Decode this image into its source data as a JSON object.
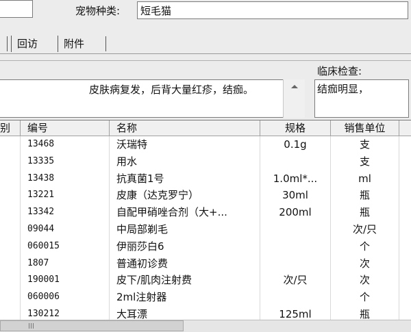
{
  "header": {
    "pet_type_label": "宠物种类:",
    "pet_type_value": "短毛猫"
  },
  "tabs": [
    {
      "label": "回访"
    },
    {
      "label": "附件"
    }
  ],
  "record": {
    "complaint_text": "皮肤病复发，后背大量红疹，结痂。",
    "clinical_label": "临床检查:",
    "clinical_text": "结痂明显，"
  },
  "grid": {
    "columns": {
      "prev": "别",
      "code": "编号",
      "name": "名称",
      "spec": "规格",
      "unit": "销售单位"
    },
    "rows": [
      {
        "code": "13468",
        "name": "沃瑞特",
        "spec": "0.1g",
        "unit": "支"
      },
      {
        "code": "13335",
        "name": "用水",
        "spec": "",
        "unit": "支"
      },
      {
        "code": "13438",
        "name": "抗真菌1号",
        "spec": "1.0ml*...",
        "unit": "ml"
      },
      {
        "code": "13221",
        "name": "皮康（达克罗宁）",
        "spec": "30ml",
        "unit": "瓶"
      },
      {
        "code": "13342",
        "name": "自配甲硝唑合剂（大+...",
        "spec": "200ml",
        "unit": "瓶"
      },
      {
        "code": "09044",
        "name": "中局部剃毛",
        "spec": "",
        "unit": "次/只"
      },
      {
        "code": "060015",
        "name": "伊丽莎白6",
        "spec": "",
        "unit": "个"
      },
      {
        "code": "1807",
        "name": "普通初诊费",
        "spec": "",
        "unit": "次"
      },
      {
        "code": "190001",
        "name": "皮下/肌肉注射费",
        "spec": "次/只",
        "unit": "次"
      },
      {
        "code": "060006",
        "name": "2ml注射器",
        "spec": "",
        "unit": "个"
      },
      {
        "code": "130212",
        "name": "大耳漂",
        "spec": "125ml",
        "unit": "瓶"
      }
    ]
  }
}
